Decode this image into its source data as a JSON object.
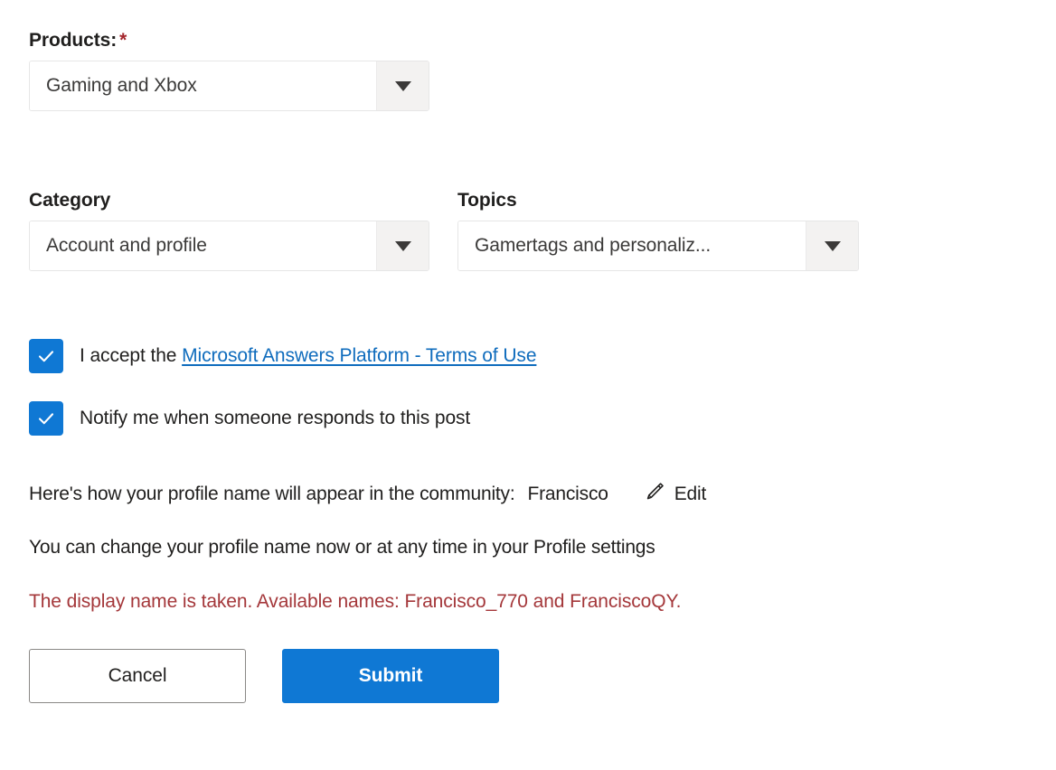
{
  "form": {
    "products": {
      "label": "Products:",
      "required_marker": "*",
      "value": "Gaming and Xbox",
      "arrow_icon": "chevron-down-icon"
    },
    "category": {
      "label": "Category",
      "value": "Account and profile",
      "arrow_icon": "chevron-down-icon"
    },
    "topics": {
      "label": "Topics",
      "value": "Gamertags and personaliz...",
      "arrow_icon": "chevron-down-icon"
    },
    "accept_terms": {
      "checked": true,
      "prefix_text": "I accept the",
      "link_text": "Microsoft Answers Platform - Terms of Use",
      "check_icon": "checkmark-icon"
    },
    "notify": {
      "checked": true,
      "label": "Notify me when someone responds to this post",
      "check_icon": "checkmark-icon"
    },
    "profile": {
      "prefix": "Here's how your profile name will appear in the community:",
      "name": "Francisco",
      "edit_icon": "pencil-icon",
      "edit_label": "Edit",
      "change_note": "You can change your profile name now or at any time in your Profile settings",
      "error_message": "The display name is taken. Available names: Francisco_770 and FranciscoQY."
    },
    "actions": {
      "cancel_label": "Cancel",
      "submit_label": "Submit"
    }
  },
  "colors": {
    "accent_blue": "#0f78d4",
    "link_blue": "#0f6cbd",
    "error_red": "#a4373a",
    "required_red": "#a4262c",
    "text_primary": "#201f1e",
    "field_bg": "#ffffff",
    "arrow_bg": "#f3f2f1",
    "border_gray": "#8a8886"
  }
}
